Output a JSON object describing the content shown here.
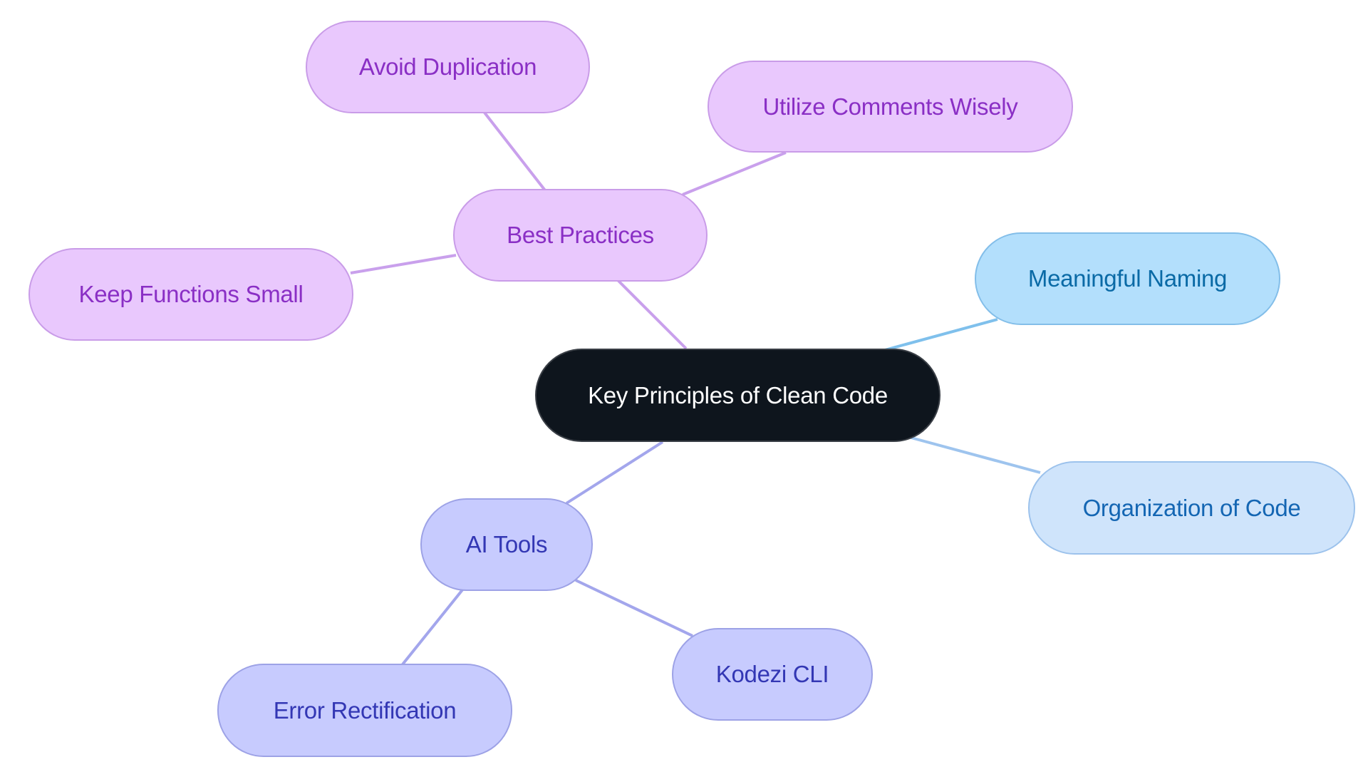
{
  "diagram": {
    "type": "mind-map",
    "root": {
      "id": "root",
      "label": "Key Principles of Clean Code"
    },
    "nodes": [
      {
        "id": "best-practices",
        "label": "Best Practices",
        "parent": "root",
        "style": "purple"
      },
      {
        "id": "avoid-duplication",
        "label": "Avoid Duplication",
        "parent": "best-practices",
        "style": "purple"
      },
      {
        "id": "utilize-comments",
        "label": "Utilize Comments Wisely",
        "parent": "best-practices",
        "style": "purple"
      },
      {
        "id": "keep-functions-small",
        "label": "Keep Functions Small",
        "parent": "best-practices",
        "style": "purple"
      },
      {
        "id": "meaningful-naming",
        "label": "Meaningful Naming",
        "parent": "root",
        "style": "blue1"
      },
      {
        "id": "organization-of-code",
        "label": "Organization of Code",
        "parent": "root",
        "style": "blue2"
      },
      {
        "id": "ai-tools",
        "label": "AI Tools",
        "parent": "root",
        "style": "indigo"
      },
      {
        "id": "error-rectification",
        "label": "Error Rectification",
        "parent": "ai-tools",
        "style": "indigo"
      },
      {
        "id": "kodezi-cli",
        "label": "Kodezi CLI",
        "parent": "ai-tools",
        "style": "indigo"
      }
    ],
    "edge_colors": {
      "best-practices": "#c9a0ec",
      "meaningful-naming": "#7fc0ec",
      "organization-of-code": "#9ec4ee",
      "ai-tools": "#a3a6ec"
    }
  }
}
